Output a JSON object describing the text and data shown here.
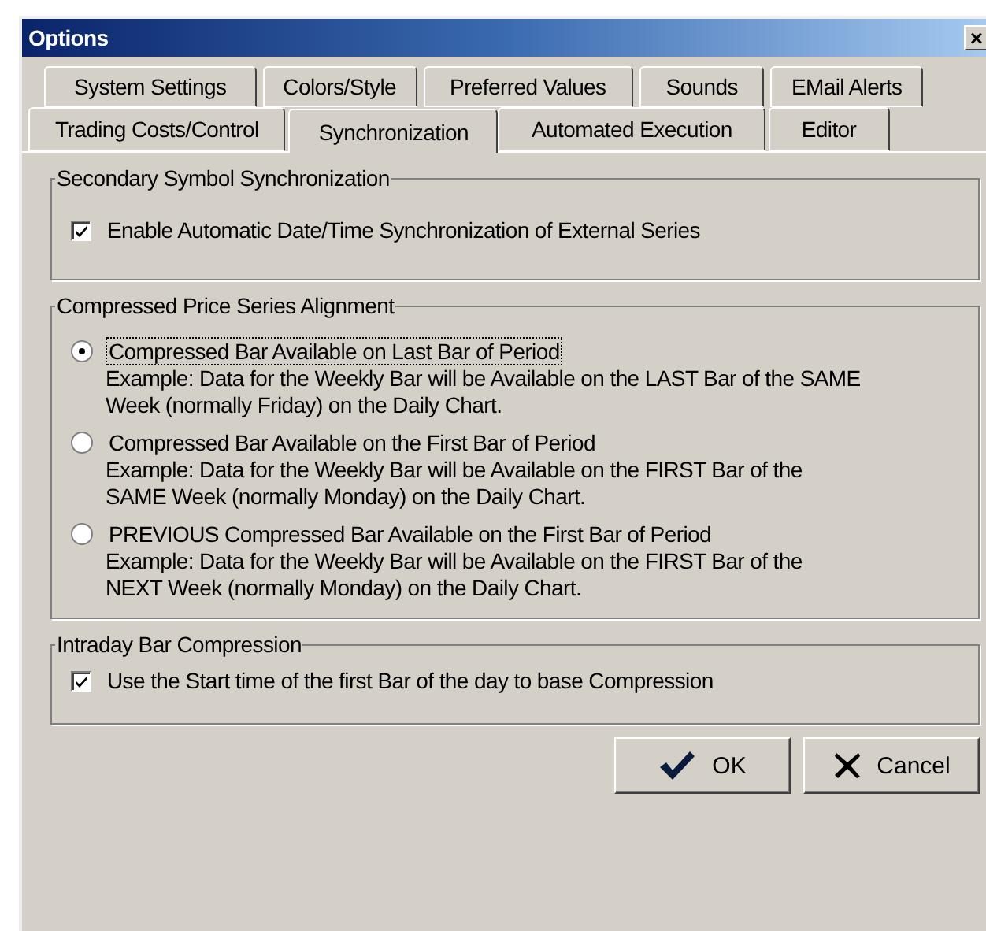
{
  "window": {
    "title": "Options",
    "close": "×"
  },
  "tab_rows": [
    {
      "tabs": [
        {
          "label": "System Settings",
          "selected": false
        },
        {
          "label": "Colors/Style",
          "selected": false
        },
        {
          "label": "Preferred Values",
          "selected": false
        },
        {
          "label": "Sounds",
          "selected": false
        },
        {
          "label": "EMail Alerts",
          "selected": false
        }
      ]
    },
    {
      "tabs": [
        {
          "label": "Trading Costs/Control",
          "selected": false
        },
        {
          "label": "Synchronization",
          "selected": true
        },
        {
          "label": "Automated Execution",
          "selected": false
        },
        {
          "label": "Editor",
          "selected": false
        }
      ]
    }
  ],
  "groups": [
    {
      "title": "Secondary Symbol Synchronization",
      "items": [
        {
          "kind": "checkbox",
          "label": "Enable Automatic Date/Time Synchronization of External Series",
          "checked": true
        }
      ]
    },
    {
      "title": "Compressed Price Series Alignment",
      "items": [
        {
          "kind": "radio",
          "label": "Compressed Bar Available on Last Bar of Period",
          "selected": true,
          "focused": true,
          "note": "Example: Data for the Weekly Bar will be Available on the LAST Bar of the SAME Week (normally Friday) on the Daily Chart."
        },
        {
          "kind": "radio",
          "label": "Compressed Bar Available on the First Bar of Period",
          "selected": false,
          "focused": false,
          "note": "Example: Data for the Weekly Bar will be Available on the FIRST Bar of the SAME Week (normally Monday) on the Daily Chart."
        },
        {
          "kind": "radio",
          "label": "PREVIOUS Compressed Bar Available on the First Bar of Period",
          "selected": false,
          "focused": false,
          "note": "Example: Data for the Weekly Bar will be Available on the FIRST Bar of the NEXT Week (normally Monday) on the Daily Chart."
        }
      ]
    },
    {
      "title": "Intraday Bar Compression",
      "items": [
        {
          "kind": "checkbox",
          "label": "Use the Start time of the first Bar of the day to base Compression",
          "checked": true
        }
      ]
    }
  ],
  "buttons": [
    {
      "kind": "ok",
      "label": "OK"
    },
    {
      "kind": "cancel",
      "label": "Cancel"
    }
  ]
}
